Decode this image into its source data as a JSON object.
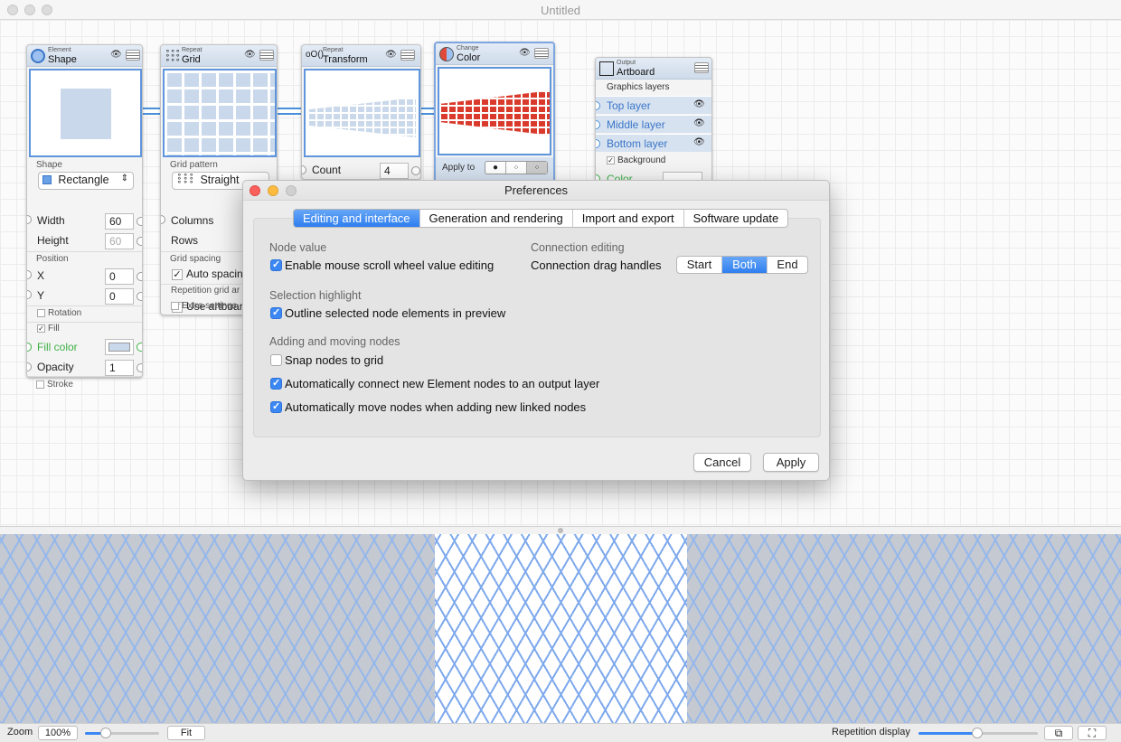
{
  "window": {
    "title": "Untitled"
  },
  "nodes": {
    "shape": {
      "type": "Element",
      "name": "Shape",
      "shape_label": "Shape",
      "shape_value": "Rectangle",
      "width_label": "Width",
      "width_value": "60",
      "height_label": "Height",
      "height_value": "60",
      "position_label": "Position",
      "x_label": "X",
      "x_value": "0",
      "y_label": "Y",
      "y_value": "0",
      "rotation_label": "Rotation",
      "fill_label": "Fill",
      "fill_color_label": "Fill color",
      "opacity_label": "Opacity",
      "opacity_value": "1",
      "stroke_label": "Stroke"
    },
    "grid": {
      "type": "Repeat",
      "name": "Grid",
      "pattern_label": "Grid pattern",
      "pattern_value": "Straight",
      "columns_label": "Columns",
      "rows_label": "Rows",
      "spacing_label": "Grid spacing",
      "auto_spacing": "Auto spacing",
      "repetition_label": "Repetition grid ar",
      "use_artboard": "Use artboard",
      "extra_settings": "Extra settings"
    },
    "transform": {
      "type": "Repeat",
      "name": "Transform",
      "count_label": "Count",
      "count_value": "4"
    },
    "color": {
      "type": "Change",
      "name": "Color",
      "apply_to": "Apply to"
    },
    "artboard": {
      "type": "Output",
      "name": "Artboard",
      "layers_label": "Graphics layers",
      "layers": [
        "Top layer",
        "Middle layer",
        "Bottom layer"
      ],
      "background": "Background",
      "color_label": "Color"
    }
  },
  "dialog": {
    "title": "Preferences",
    "tabs": [
      "Editing and interface",
      "Generation and rendering",
      "Import and export",
      "Software update"
    ],
    "node_value_label": "Node value",
    "scroll_edit": "Enable mouse scroll wheel value editing",
    "connection_label": "Connection editing",
    "drag_handles": "Connection drag handles",
    "handle_options": [
      "Start",
      "Both",
      "End"
    ],
    "selection_label": "Selection highlight",
    "outline": "Outline selected node elements in preview",
    "adding_label": "Adding and moving nodes",
    "snap": "Snap nodes to grid",
    "auto_connect": "Automatically connect new Element nodes to an output layer",
    "auto_move": "Automatically move nodes when adding new linked nodes",
    "cancel": "Cancel",
    "apply": "Apply"
  },
  "statusbar": {
    "zoom_label": "Zoom",
    "zoom_value": "100%",
    "fit": "Fit",
    "repetition_display": "Repetition display"
  },
  "colors": {
    "accent": "#3b87f3",
    "link": "#4a90d9",
    "red_cells": "#d93a2b"
  }
}
